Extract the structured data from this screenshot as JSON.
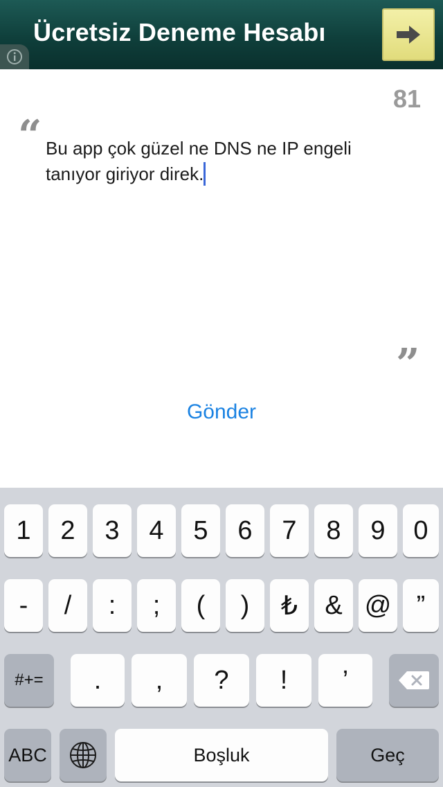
{
  "header": {
    "title": "Ücretsiz Deneme Hesabı",
    "next_icon": "arrow-right-icon",
    "info_icon": "info-icon",
    "next_color": "#e4df80"
  },
  "comment": {
    "remaining_count": "81",
    "text": "Bu app çok güzel ne DNS ne IP engeli tanıyor giriyor direk.",
    "open_quote": "“",
    "close_quote": "”"
  },
  "send_label": "Gönder",
  "accent_color": "#1a82e2",
  "keyboard": {
    "row1": [
      "1",
      "2",
      "3",
      "4",
      "5",
      "6",
      "7",
      "8",
      "9",
      "0"
    ],
    "row2": [
      "-",
      "/",
      ":",
      ";",
      "(",
      ")",
      "₺",
      "&",
      "@",
      "”"
    ],
    "row3_mode": "#+=",
    "row3": [
      ".",
      ",",
      "?",
      "!",
      "’"
    ],
    "backspace_icon": "backspace-icon",
    "abc": "ABC",
    "globe_icon": "globe-icon",
    "space": "Boşluk",
    "go": "Geç"
  }
}
